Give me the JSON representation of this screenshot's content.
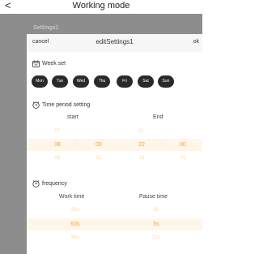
{
  "header": {
    "title": "Working mode",
    "back_glyph": "<"
  },
  "background": {
    "settings_title": "Settings1"
  },
  "sheet": {
    "cancel_label": "cancel",
    "title": "editSettings1",
    "ok_label": "ok"
  },
  "week": {
    "label": "Week set",
    "icon": "calendar-icon",
    "days": [
      "Mon",
      "Tue",
      "Wed",
      "Thu",
      "Fri",
      "Sat",
      "Sun"
    ]
  },
  "time": {
    "label": "Time period setting",
    "icon": "clock-icon",
    "start_label": "start",
    "end_label": "End",
    "separator": ":",
    "start": {
      "hour_prev": "07",
      "hour": "08",
      "hour_next": "09",
      "minute_prev": "59",
      "minute": "00",
      "minute_next": "01"
    },
    "end": {
      "hour_prev": "21",
      "hour": "22",
      "hour_next": "23",
      "minute_prev": "59",
      "minute": "00",
      "minute_next": "01"
    }
  },
  "frequency": {
    "label": "frequency",
    "icon": "clock-icon",
    "work_label": "Work time",
    "pause_label": "Pause time",
    "work_prev": "55s",
    "work": "60s",
    "work_next": "65s",
    "pause_prev": "5s",
    "pause": "5s",
    "pause_next": "10s"
  },
  "colors": {
    "accent": "#f0a230",
    "accent_faint": "#f6d9ab",
    "day_chip": "#2a2a2a",
    "overlay": "#8d8d8d"
  }
}
